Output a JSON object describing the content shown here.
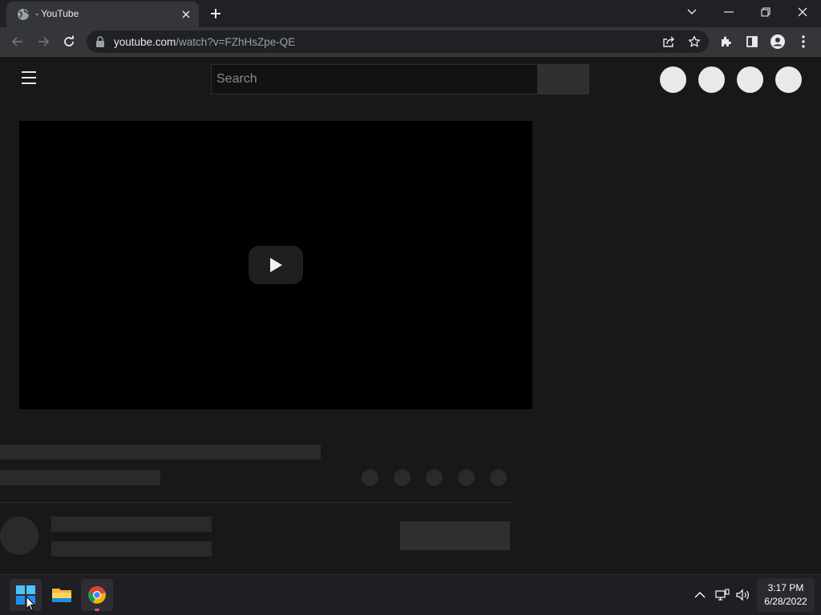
{
  "browser": {
    "tab": {
      "title": "- YouTube"
    },
    "url": {
      "host": "youtube.com",
      "path": "/watch?v=FZhHsZpe-QE"
    }
  },
  "page": {
    "search": {
      "placeholder": "Search"
    }
  },
  "taskbar": {
    "clock": {
      "time": "3:17 PM",
      "date": "6/28/2022"
    }
  }
}
